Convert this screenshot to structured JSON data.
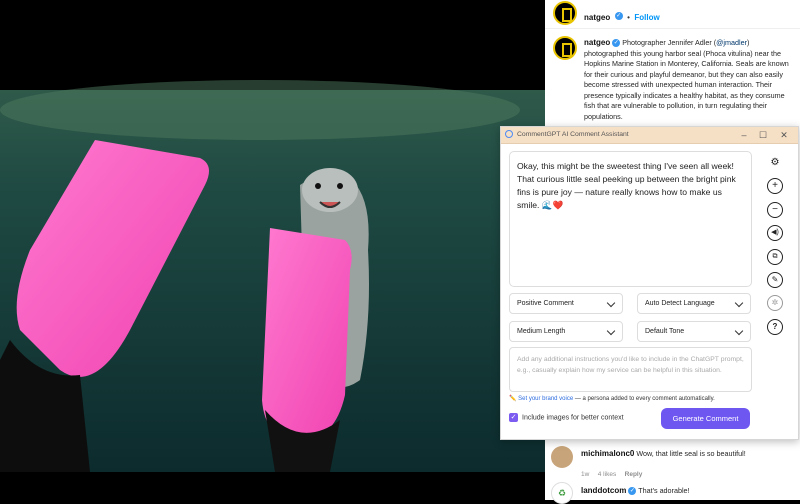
{
  "post": {
    "author": "natgeo",
    "follow_label": "Follow",
    "dot": "•",
    "caption_prefix": "Photographer Jennifer Adler (",
    "mention": "@jmadler",
    "caption_body": ") photographed this young harbor seal (Phoca vitulina) near the Hopkins Marine Station in Monterey, California. Seals are known for their curious and playful demeanor, but they can also easily become stressed with unexpected human interaction. Their presence typically indicates a healthy habitat, as they consume fish that are vulnerable to pollution, in turn regulating their populations."
  },
  "assistant": {
    "title": "CommentGPT AI Comment Assistant",
    "generated_comment": "Okay, this might be the sweetest thing I've seen all week! That curious little seal peeking up between the bright pink fins is pure joy — nature really knows how to make us smile. 🌊❤️",
    "tone_select": "Positive Comment",
    "language_select": "Auto Detect Language",
    "length_select": "Medium Length",
    "style_select": "Default Tone",
    "instructions_placeholder": "Add any additional instructions you'd like to include in the ChatGPT prompt, e.g., casually explain how my service can be helpful in this situation.",
    "brand_link": "Set your brand voice",
    "brand_note": " — a persona added to every comment automatically.",
    "include_images_label": "Include images for better context",
    "generate_button": "Generate Comment",
    "side_icons": [
      "gear-icon",
      "plus-icon",
      "minus-icon",
      "speaker-icon",
      "copy-icon",
      "pencil-icon",
      "openai-icon",
      "help-icon"
    ]
  },
  "comments": [
    {
      "user": "michimalonc0",
      "text": "Wow, that little seal is so beautiful!",
      "age": "1w",
      "likes": "4 likes",
      "reply": "Reply"
    },
    {
      "user": "landdotcom",
      "text": "That's adorable!"
    }
  ],
  "colors": {
    "accent": "#6e56f0",
    "fin": "#ff5fbf",
    "titlebar": "#f5dfc5",
    "link": "#0095f6"
  }
}
